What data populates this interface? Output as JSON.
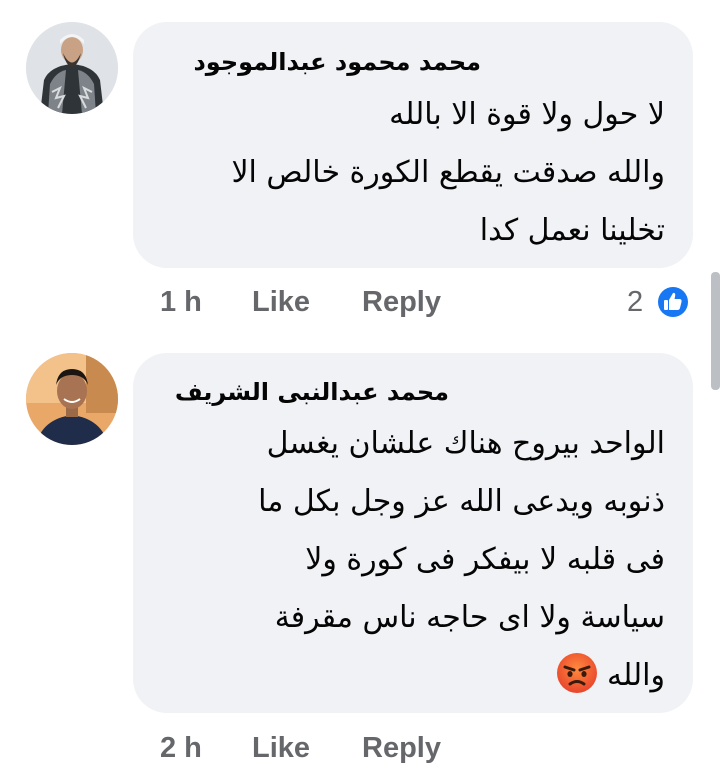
{
  "comments": [
    {
      "author": "محمد محمود عبدالموجود",
      "lines": [
        "لا حول ولا قوة الا بالله",
        "والله صدقت يقطع الكورة خالص الا",
        "تخلينا نعمل كدا"
      ],
      "time": "1 h",
      "like_label": "Like",
      "reply_label": "Reply",
      "reaction_count": "2",
      "reaction_icon": "like-icon"
    },
    {
      "author": "محمد عبدالنبى الشريف",
      "lines": [
        "الواحد بيروح هناك علشان يغسل",
        "ذنوبه ويدعى الله عز وجل بكل ما",
        "فى قلبه لا بيفكر فى كورة ولا",
        "سياسة ولا اى حاجه ناس مقرفة",
        "والله"
      ],
      "emoji": "angry-face-emoji",
      "time": "2 h",
      "like_label": "Like",
      "reply_label": "Reply"
    }
  ],
  "colors": {
    "bubble": "#f0f2f5",
    "meta_text": "#65676b",
    "like_blue": "#1877f2",
    "angry_orange": "#f26522"
  }
}
